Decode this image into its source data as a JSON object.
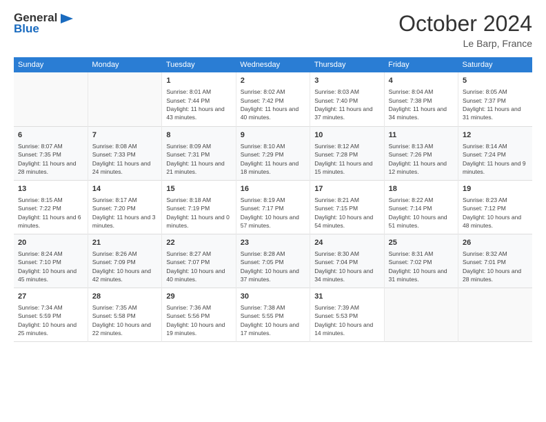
{
  "header": {
    "logo_general": "General",
    "logo_blue": "Blue",
    "month": "October 2024",
    "location": "Le Barp, France"
  },
  "days_of_week": [
    "Sunday",
    "Monday",
    "Tuesday",
    "Wednesday",
    "Thursday",
    "Friday",
    "Saturday"
  ],
  "weeks": [
    [
      {
        "day": "",
        "sunrise": "",
        "sunset": "",
        "daylight": ""
      },
      {
        "day": "",
        "sunrise": "",
        "sunset": "",
        "daylight": ""
      },
      {
        "day": "1",
        "sunrise": "Sunrise: 8:01 AM",
        "sunset": "Sunset: 7:44 PM",
        "daylight": "Daylight: 11 hours and 43 minutes."
      },
      {
        "day": "2",
        "sunrise": "Sunrise: 8:02 AM",
        "sunset": "Sunset: 7:42 PM",
        "daylight": "Daylight: 11 hours and 40 minutes."
      },
      {
        "day": "3",
        "sunrise": "Sunrise: 8:03 AM",
        "sunset": "Sunset: 7:40 PM",
        "daylight": "Daylight: 11 hours and 37 minutes."
      },
      {
        "day": "4",
        "sunrise": "Sunrise: 8:04 AM",
        "sunset": "Sunset: 7:38 PM",
        "daylight": "Daylight: 11 hours and 34 minutes."
      },
      {
        "day": "5",
        "sunrise": "Sunrise: 8:05 AM",
        "sunset": "Sunset: 7:37 PM",
        "daylight": "Daylight: 11 hours and 31 minutes."
      }
    ],
    [
      {
        "day": "6",
        "sunrise": "Sunrise: 8:07 AM",
        "sunset": "Sunset: 7:35 PM",
        "daylight": "Daylight: 11 hours and 28 minutes."
      },
      {
        "day": "7",
        "sunrise": "Sunrise: 8:08 AM",
        "sunset": "Sunset: 7:33 PM",
        "daylight": "Daylight: 11 hours and 24 minutes."
      },
      {
        "day": "8",
        "sunrise": "Sunrise: 8:09 AM",
        "sunset": "Sunset: 7:31 PM",
        "daylight": "Daylight: 11 hours and 21 minutes."
      },
      {
        "day": "9",
        "sunrise": "Sunrise: 8:10 AM",
        "sunset": "Sunset: 7:29 PM",
        "daylight": "Daylight: 11 hours and 18 minutes."
      },
      {
        "day": "10",
        "sunrise": "Sunrise: 8:12 AM",
        "sunset": "Sunset: 7:28 PM",
        "daylight": "Daylight: 11 hours and 15 minutes."
      },
      {
        "day": "11",
        "sunrise": "Sunrise: 8:13 AM",
        "sunset": "Sunset: 7:26 PM",
        "daylight": "Daylight: 11 hours and 12 minutes."
      },
      {
        "day": "12",
        "sunrise": "Sunrise: 8:14 AM",
        "sunset": "Sunset: 7:24 PM",
        "daylight": "Daylight: 11 hours and 9 minutes."
      }
    ],
    [
      {
        "day": "13",
        "sunrise": "Sunrise: 8:15 AM",
        "sunset": "Sunset: 7:22 PM",
        "daylight": "Daylight: 11 hours and 6 minutes."
      },
      {
        "day": "14",
        "sunrise": "Sunrise: 8:17 AM",
        "sunset": "Sunset: 7:20 PM",
        "daylight": "Daylight: 11 hours and 3 minutes."
      },
      {
        "day": "15",
        "sunrise": "Sunrise: 8:18 AM",
        "sunset": "Sunset: 7:19 PM",
        "daylight": "Daylight: 11 hours and 0 minutes."
      },
      {
        "day": "16",
        "sunrise": "Sunrise: 8:19 AM",
        "sunset": "Sunset: 7:17 PM",
        "daylight": "Daylight: 10 hours and 57 minutes."
      },
      {
        "day": "17",
        "sunrise": "Sunrise: 8:21 AM",
        "sunset": "Sunset: 7:15 PM",
        "daylight": "Daylight: 10 hours and 54 minutes."
      },
      {
        "day": "18",
        "sunrise": "Sunrise: 8:22 AM",
        "sunset": "Sunset: 7:14 PM",
        "daylight": "Daylight: 10 hours and 51 minutes."
      },
      {
        "day": "19",
        "sunrise": "Sunrise: 8:23 AM",
        "sunset": "Sunset: 7:12 PM",
        "daylight": "Daylight: 10 hours and 48 minutes."
      }
    ],
    [
      {
        "day": "20",
        "sunrise": "Sunrise: 8:24 AM",
        "sunset": "Sunset: 7:10 PM",
        "daylight": "Daylight: 10 hours and 45 minutes."
      },
      {
        "day": "21",
        "sunrise": "Sunrise: 8:26 AM",
        "sunset": "Sunset: 7:09 PM",
        "daylight": "Daylight: 10 hours and 42 minutes."
      },
      {
        "day": "22",
        "sunrise": "Sunrise: 8:27 AM",
        "sunset": "Sunset: 7:07 PM",
        "daylight": "Daylight: 10 hours and 40 minutes."
      },
      {
        "day": "23",
        "sunrise": "Sunrise: 8:28 AM",
        "sunset": "Sunset: 7:05 PM",
        "daylight": "Daylight: 10 hours and 37 minutes."
      },
      {
        "day": "24",
        "sunrise": "Sunrise: 8:30 AM",
        "sunset": "Sunset: 7:04 PM",
        "daylight": "Daylight: 10 hours and 34 minutes."
      },
      {
        "day": "25",
        "sunrise": "Sunrise: 8:31 AM",
        "sunset": "Sunset: 7:02 PM",
        "daylight": "Daylight: 10 hours and 31 minutes."
      },
      {
        "day": "26",
        "sunrise": "Sunrise: 8:32 AM",
        "sunset": "Sunset: 7:01 PM",
        "daylight": "Daylight: 10 hours and 28 minutes."
      }
    ],
    [
      {
        "day": "27",
        "sunrise": "Sunrise: 7:34 AM",
        "sunset": "Sunset: 5:59 PM",
        "daylight": "Daylight: 10 hours and 25 minutes."
      },
      {
        "day": "28",
        "sunrise": "Sunrise: 7:35 AM",
        "sunset": "Sunset: 5:58 PM",
        "daylight": "Daylight: 10 hours and 22 minutes."
      },
      {
        "day": "29",
        "sunrise": "Sunrise: 7:36 AM",
        "sunset": "Sunset: 5:56 PM",
        "daylight": "Daylight: 10 hours and 19 minutes."
      },
      {
        "day": "30",
        "sunrise": "Sunrise: 7:38 AM",
        "sunset": "Sunset: 5:55 PM",
        "daylight": "Daylight: 10 hours and 17 minutes."
      },
      {
        "day": "31",
        "sunrise": "Sunrise: 7:39 AM",
        "sunset": "Sunset: 5:53 PM",
        "daylight": "Daylight: 10 hours and 14 minutes."
      },
      {
        "day": "",
        "sunrise": "",
        "sunset": "",
        "daylight": ""
      },
      {
        "day": "",
        "sunrise": "",
        "sunset": "",
        "daylight": ""
      }
    ]
  ]
}
